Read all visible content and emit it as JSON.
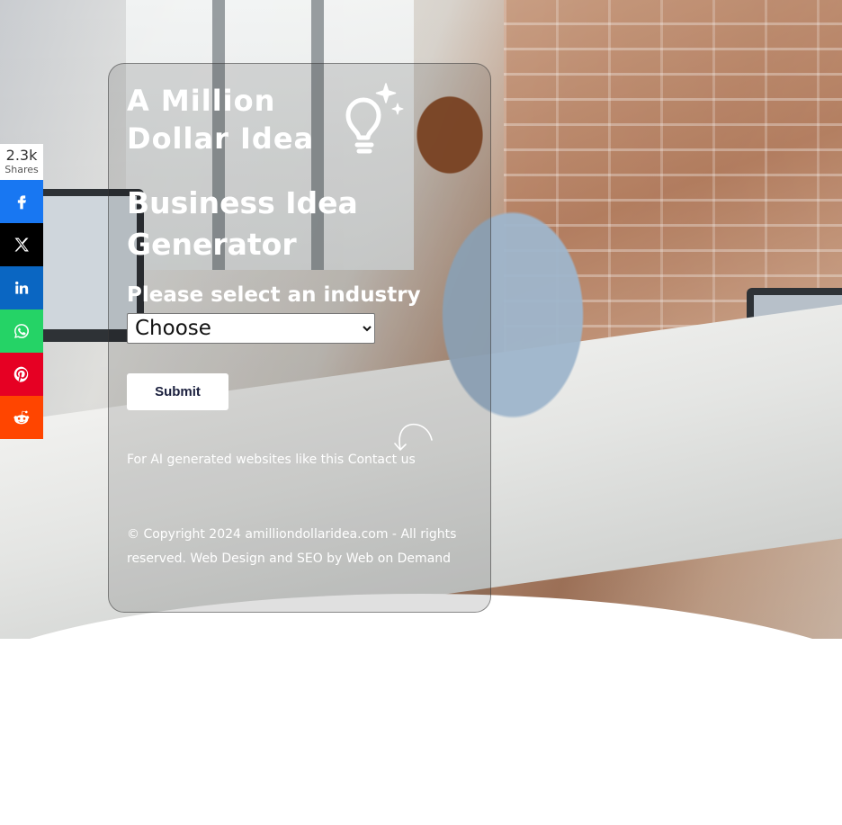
{
  "share": {
    "count": "2.3k",
    "count_label": "Shares",
    "buttons": [
      {
        "network": "facebook",
        "icon": "facebook-icon",
        "color": "#1877f2"
      },
      {
        "network": "x",
        "icon": "x-icon",
        "color": "#000000"
      },
      {
        "network": "linkedin",
        "icon": "linkedin-icon",
        "color": "#0a66c2"
      },
      {
        "network": "whatsapp",
        "icon": "whatsapp-icon",
        "color": "#25d366"
      },
      {
        "network": "pinterest",
        "icon": "pinterest-icon",
        "color": "#e60023"
      },
      {
        "network": "reddit",
        "icon": "reddit-icon",
        "color": "#ff4500"
      }
    ]
  },
  "logo": {
    "line1": "A Million",
    "line2": "Dollar Idea",
    "icon": "lightbulb-sparkle-icon"
  },
  "page": {
    "title": "Business Idea Generator"
  },
  "form": {
    "label": "Please select an industry",
    "select_value": "Choose",
    "submit_label": "Submit"
  },
  "contact": {
    "text": "For AI generated websites like this",
    "link_label": "Contact us"
  },
  "footer": {
    "copyright": "© Copyright 2024 amilliondollaridea.com - All rights reserved.",
    "credit_link": "Web Design and SEO by Web on Demand"
  }
}
